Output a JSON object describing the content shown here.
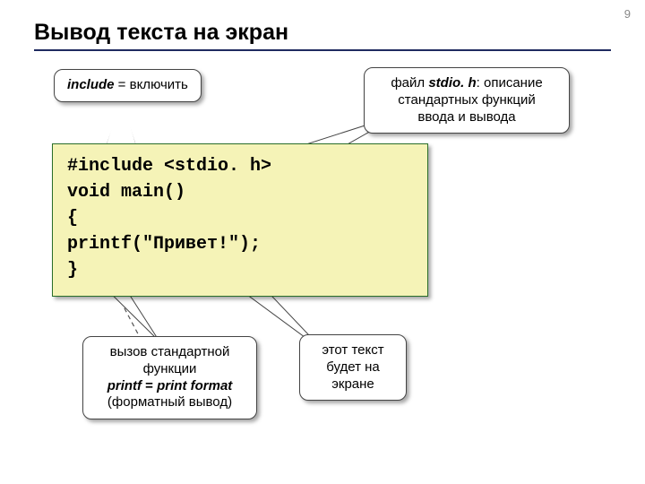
{
  "page_number": "9",
  "title": "Вывод текста на экран",
  "callouts": {
    "include": {
      "html": "<b><i>include</i></b> = включить"
    },
    "stdio": {
      "html": "файл <b><i>stdio. h</i></b>: описание<br>стандартных функций<br>ввода и вывода"
    },
    "printf": {
      "html": "вызов стандартной<br>функции<br><b><i>printf</i> = <i>print format</i></b><br>(форматный вывод)"
    },
    "screen": {
      "html": "этот текст<br>будет на<br>экране"
    }
  },
  "code": {
    "l1": "#include <stdio. h>",
    "l2": "void main()",
    "l3": "{",
    "l4": "printf(\"Привет!\");",
    "l5": "}"
  }
}
